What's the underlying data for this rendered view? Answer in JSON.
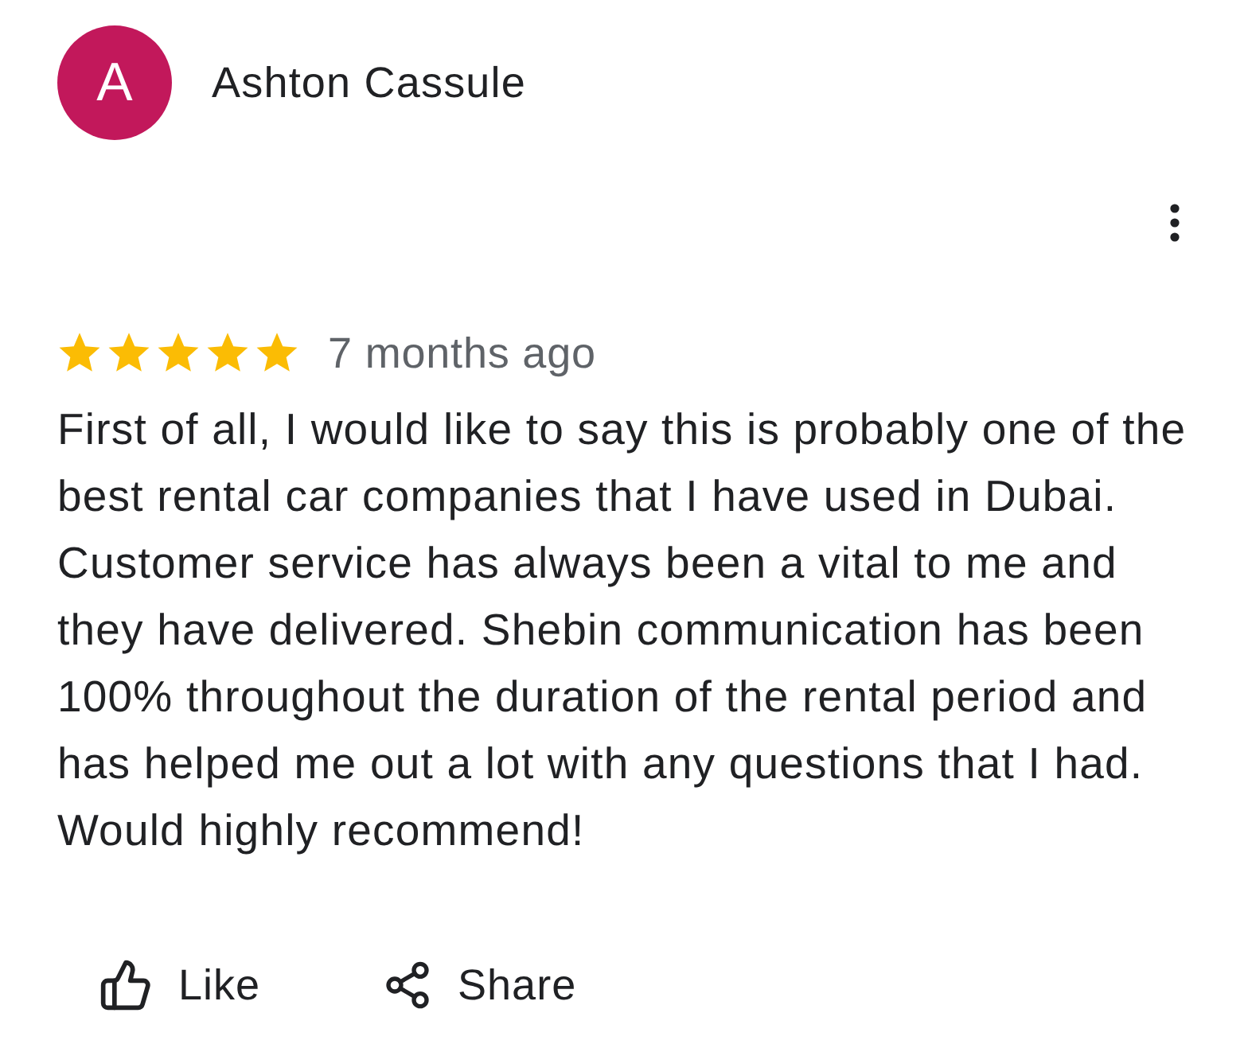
{
  "reviewer": {
    "initial": "A",
    "name": "Ashton Cassule"
  },
  "review": {
    "stars": 5,
    "time": "7 months ago",
    "text": "First of all, I would like to say this is probably one of the best rental car companies that I have used in Dubai. Customer service has always been a vital to me and they have delivered. Shebin communication has been 100% throughout the duration of the rental period and has helped me out a lot with any questions that I had. Would highly recommend!"
  },
  "actions": [
    {
      "kind": "like",
      "label": "Like"
    },
    {
      "kind": "share",
      "label": "Share"
    }
  ]
}
